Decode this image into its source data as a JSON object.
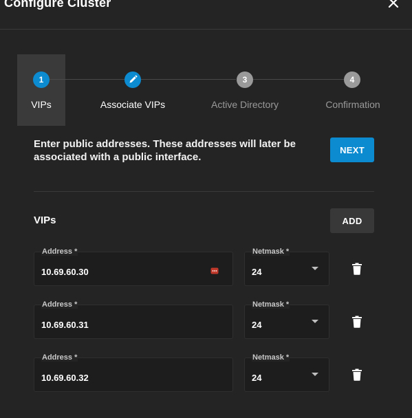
{
  "dialog": {
    "title": "Configure Cluster",
    "close_icon": "close-icon"
  },
  "stepper": {
    "steps": [
      {
        "marker": "1",
        "label": "VIPs",
        "state": "active",
        "color": "#0d8bd1"
      },
      {
        "marker": "edit-icon",
        "label": "Associate VIPs",
        "state": "editable",
        "color": "#0d8bd1"
      },
      {
        "marker": "3",
        "label": "Active Directory",
        "state": "pending",
        "color": "#9a9a9a"
      },
      {
        "marker": "4",
        "label": "Confirmation",
        "state": "pending",
        "color": "#9a9a9a"
      }
    ]
  },
  "intro": {
    "text": "Enter public addresses. These addresses will later be associated with a public interface."
  },
  "buttons": {
    "next": "NEXT",
    "add": "ADD"
  },
  "vips": {
    "title": "VIPs",
    "rows": [
      {
        "address_label": "Address *",
        "address": "10.69.60.30",
        "netmask_label": "Netmask *",
        "netmask": "24",
        "has_password_icon": true
      },
      {
        "address_label": "Address *",
        "address": "10.69.60.31",
        "netmask_label": "Netmask *",
        "netmask": "24",
        "has_password_icon": false
      },
      {
        "address_label": "Address *",
        "address": "10.69.60.32",
        "netmask_label": "Netmask *",
        "netmask": "24",
        "has_password_icon": false
      }
    ]
  },
  "colors": {
    "accent": "#0d8bd1",
    "background": "#242424",
    "input_background": "#1d1d1d",
    "inactive_step": "#9a9a9a"
  }
}
